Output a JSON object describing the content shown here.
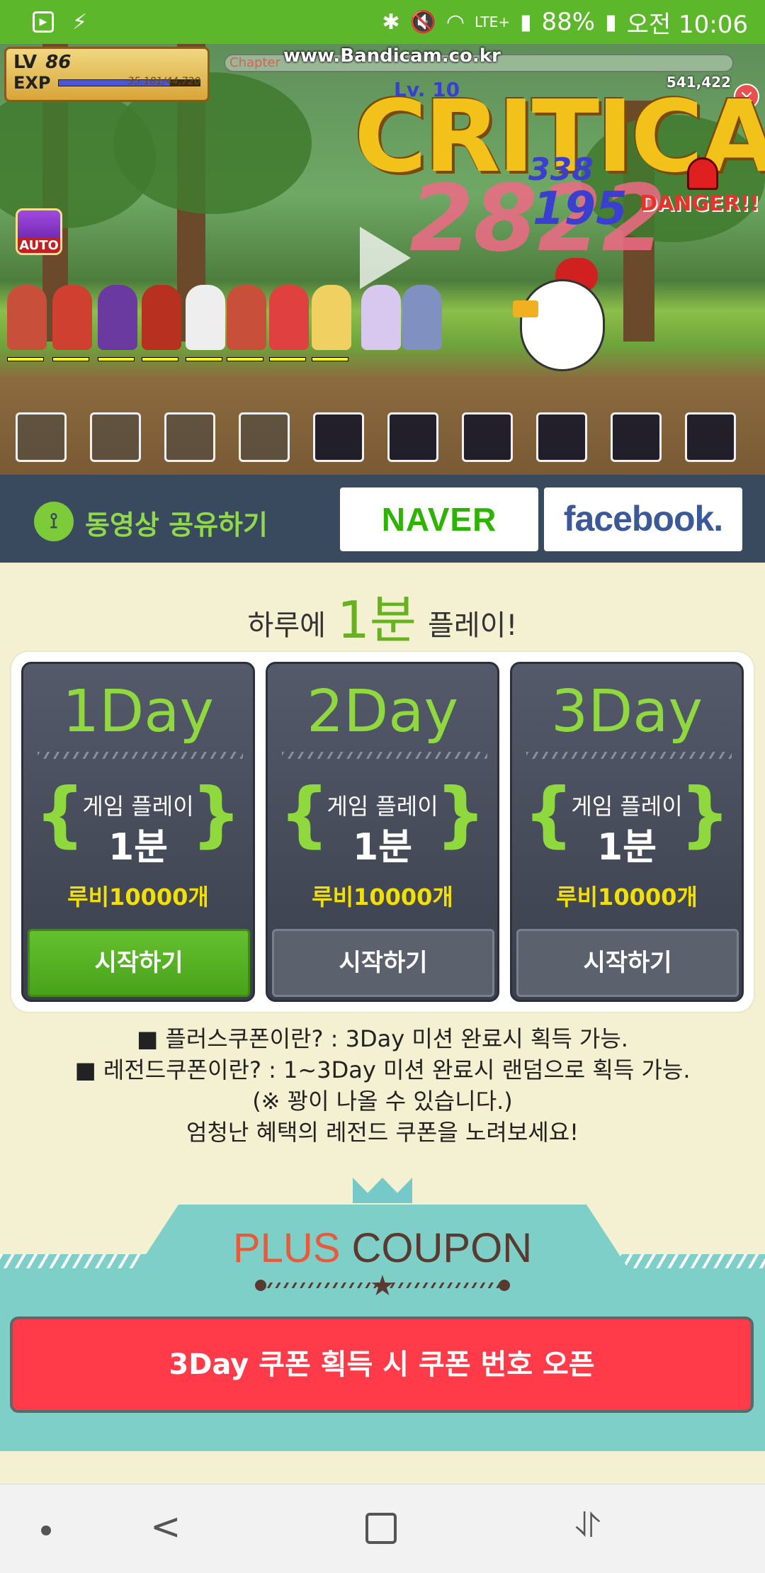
{
  "status_bar": {
    "battery": "88%",
    "network": "LTE+",
    "time": "오전 10:06",
    "bg_color": "#5cb82a"
  },
  "video": {
    "hud_level_label": "LV",
    "hud_level_value": "86",
    "hud_exp_label": "EXP",
    "hud_exp_text": "35,181/44,720",
    "hud_exp_fraction": 0.79,
    "watermark": "www.Bandicam.co.kr",
    "chapter_label": "Chapter",
    "boss_level": "Lv. 10",
    "score": "541,422",
    "critical_text": "CRITICAL",
    "damage_numbers": [
      "2822",
      "195",
      "338"
    ],
    "danger_text": "DANGER!!",
    "auto_label": "AUTO",
    "play_icon": "play-icon"
  },
  "share": {
    "label": "동영상 공유하기",
    "icon": "share-icon",
    "naver_label": "NAVER",
    "facebook_label": "facebook."
  },
  "headline": {
    "prefix": "하루에",
    "highlight": "1분",
    "suffix": "플레이!"
  },
  "cards": [
    {
      "day": "1Day",
      "label": "게임 플레이",
      "minutes": "1분",
      "reward": "루비10000개",
      "button": "시작하기",
      "active": true
    },
    {
      "day": "2Day",
      "label": "게임 플레이",
      "minutes": "1분",
      "reward": "루비10000개",
      "button": "시작하기",
      "active": false
    },
    {
      "day": "3Day",
      "label": "게임 플레이",
      "minutes": "1분",
      "reward": "루비10000개",
      "button": "시작하기",
      "active": false
    }
  ],
  "notes": [
    "■ 플러스쿠폰이란? : 3Day 미션 완료시 획득 가능.",
    "■ 레전드쿠폰이란? : 1~3Day 미션 완료시 랜덤으로 획득 가능.",
    "(※ 꽝이 나올 수 있습니다.)",
    "엄청난 혜택의 레전드 쿠폰을 노려보세요!"
  ],
  "coupon": {
    "title_plus": "PLUS",
    "title_coupon": "COUPON",
    "button": "3Day 쿠폰 획득 시 쿠폰 번호 오픈"
  },
  "colors": {
    "accent_green": "#8fd93f",
    "reward_yellow": "#f4e000",
    "coupon_red": "#ff3b4a",
    "coupon_teal": "#7dcfc8"
  }
}
